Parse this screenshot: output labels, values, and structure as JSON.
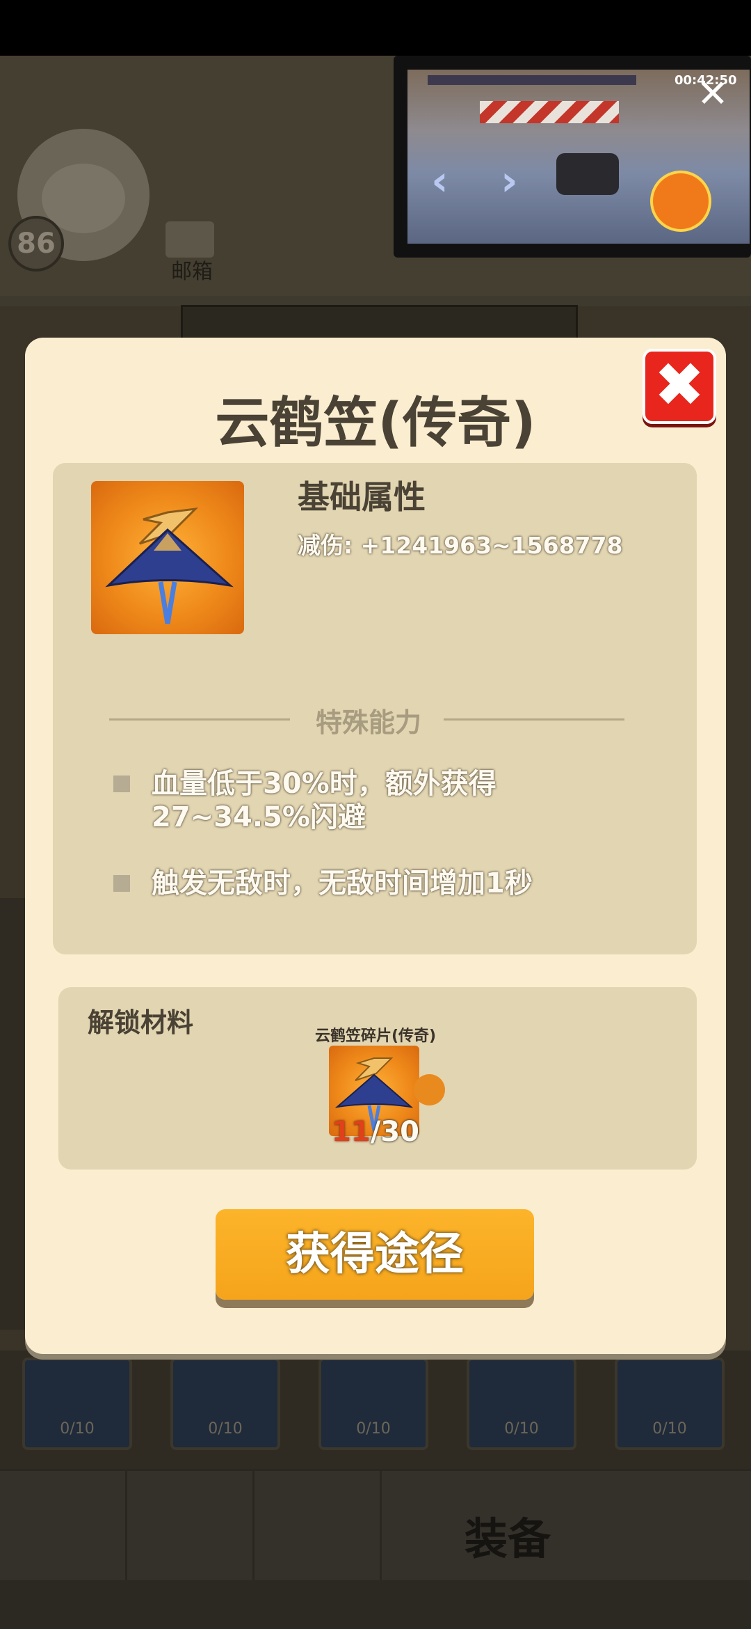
{
  "background": {
    "level": "86",
    "mail_label": "邮箱",
    "slot_progress": [
      "0/10",
      "0/10",
      "0/10",
      "0/10",
      "0/10"
    ],
    "nav_equipment_label": "装备"
  },
  "video_overlay": {
    "timer": "00:42:50",
    "close_symbol": "✕"
  },
  "modal": {
    "title": "云鹤笠(传奇)",
    "close_symbol": "✖",
    "item_icon": "crane-hat-icon",
    "basic_section": {
      "title": "基础属性",
      "stat": "减伤: +1241963~1568778"
    },
    "special_section": {
      "title": "特殊能力",
      "abilities": [
        "血量低于30%时，额外获得27~34.5%闪避",
        "触发无敌时，无敌时间增加1秒"
      ]
    },
    "unlock_section": {
      "title": "解锁材料",
      "material_name": "云鹤笠碎片(传奇)",
      "owned": "11",
      "required": "/30"
    },
    "obtain_button_label": "获得途径"
  },
  "colors": {
    "modal_bg": "#fbedd0",
    "panel_bg": "#e2d5b2",
    "accent_orange": "#f5a41b",
    "close_red": "#e8261d"
  }
}
